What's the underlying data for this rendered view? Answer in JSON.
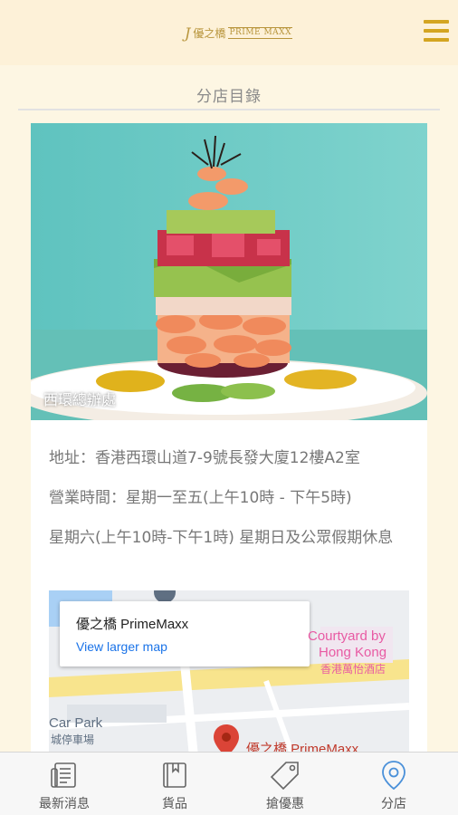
{
  "header": {
    "logo_mark": "J",
    "logo_cn": "優之橋",
    "logo_en": "PRIME MAXX",
    "menu_icon": "hamburger-icon"
  },
  "section": {
    "title": "分店目錄"
  },
  "branch": {
    "name": "西環總辦處",
    "address": "地址：香港西環山道7-9號長發大廈12樓A2室",
    "hours_weekday": "營業時間：星期一至五(上午10時 - 下午5時)",
    "hours_weekend": "星期六(上午10時-下午1時) 星期日及公眾假期休息"
  },
  "map": {
    "card_title": "優之橋 PrimeMaxx",
    "card_link": "View larger map",
    "label_courtyard_en_1": "Courtyard by",
    "label_courtyard_en_2": "Hong Kong",
    "label_courtyard_cn": "香港萬怡酒店",
    "label_carpark_en": "Car Park",
    "label_carpark_cn": "城停車場",
    "label_marker": "優之橋 PrimeMaxx",
    "pin_color": "#db4437",
    "poi_color": "#e85aa3"
  },
  "tabs": [
    {
      "label": "最新消息",
      "icon": "news-icon"
    },
    {
      "label": "貨品",
      "icon": "book-icon"
    },
    {
      "label": "搶優惠",
      "icon": "tag-icon"
    },
    {
      "label": "分店",
      "icon": "location-pin-icon",
      "active": true
    }
  ],
  "colors": {
    "accent": "#d4a521",
    "active_tab": "#4a90d9",
    "background": "#fdf6e3"
  }
}
